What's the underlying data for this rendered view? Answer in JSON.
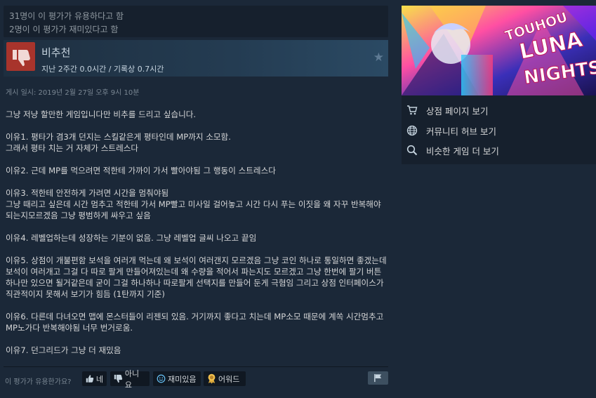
{
  "helpful": {
    "helpful_line": "31명이 이 평가가 유용하다고 함",
    "funny_line": "2명이 이 평가가 재미있다고 함"
  },
  "recommendation": {
    "title": "비추천",
    "hours": "지난 2주간 0.0시간 / 기록상 0.7시간"
  },
  "post_date": "게시 일시: 2019년 2월 27일 오후 9시 10분",
  "review_paragraphs": [
    "그냥 저냥 할만한 게임입니다만 비추를 드리고 싶습니다.",
    "이유1. 평타가 겸3개 던지는 스킬같은게 평타인데 MP까지 소모함.\n그래서 평타 치는 거 자체가 스트레스다",
    "이유2. 근데 MP를 먹으려면 적한테 가까이 가서 빨아야됨 그 행동이 스트레스다",
    "이유3. 적한테 안전하게 가려면 시간을 멈춰야됨\n그냥 때리고 싶은데 시간 멈추고 적한테 가서 MP빨고 미사일 걸어놓고 시간 다시 푸는 이짓을 왜 자꾸 반복해야되는지모르겠음 그냥 평범하게 싸우고 싶음",
    "이유4. 레벨업하는데 성장하는 기분이 없음. 그냥 레벨업 글씨 나오고 끝임",
    "이유5. 상점이 개불편함 보석을 여러개 먹는데 왜 보석이 여러갠지 모르겠음 그냥 코인 하나로 통일하면 좋겠는데 보석이 여러개고 그걸 다 따로 팔게 만들어져있는데 왜 수량을 적어서 파는지도 모르겠고 그냥 한번에 팔기 버튼 하나만 있으면 될거같은데 굳이 그걸 하나하나 따로팔게 선택지를 만들어 둔게 극혐임 그리고 상점 인터페이스가 직관적이지 못해서 보기가 힘듬 (1탄까지 기준)",
    "이유6. 다른데 다녀오면 맵에 몬스터들이 리젠되 있음. 거기까지 좋다고 치는데 MP소모 때문에 계쏙 시간멈추고 MP노가다 반복해야됨 너무 번거로움.",
    "이유7. 던그리드가 그냥 더 재밌음"
  ],
  "vote": {
    "question": "이 평가가 유용한가요?",
    "yes": "네",
    "no": "아니요",
    "funny": "재미있음",
    "award": "어워드"
  },
  "sidebar": {
    "store_page": "상점 페이지 보기",
    "community_hub": "커뮤니티 허브 보기",
    "more_games": "비슷한 게임 더 보기",
    "banner_text": "TOUHOU LUNA NIGHTS"
  },
  "colors": {
    "background": "#1b2838",
    "thumbs_down": "#a8342c",
    "text_light": "#d6d7d8"
  }
}
